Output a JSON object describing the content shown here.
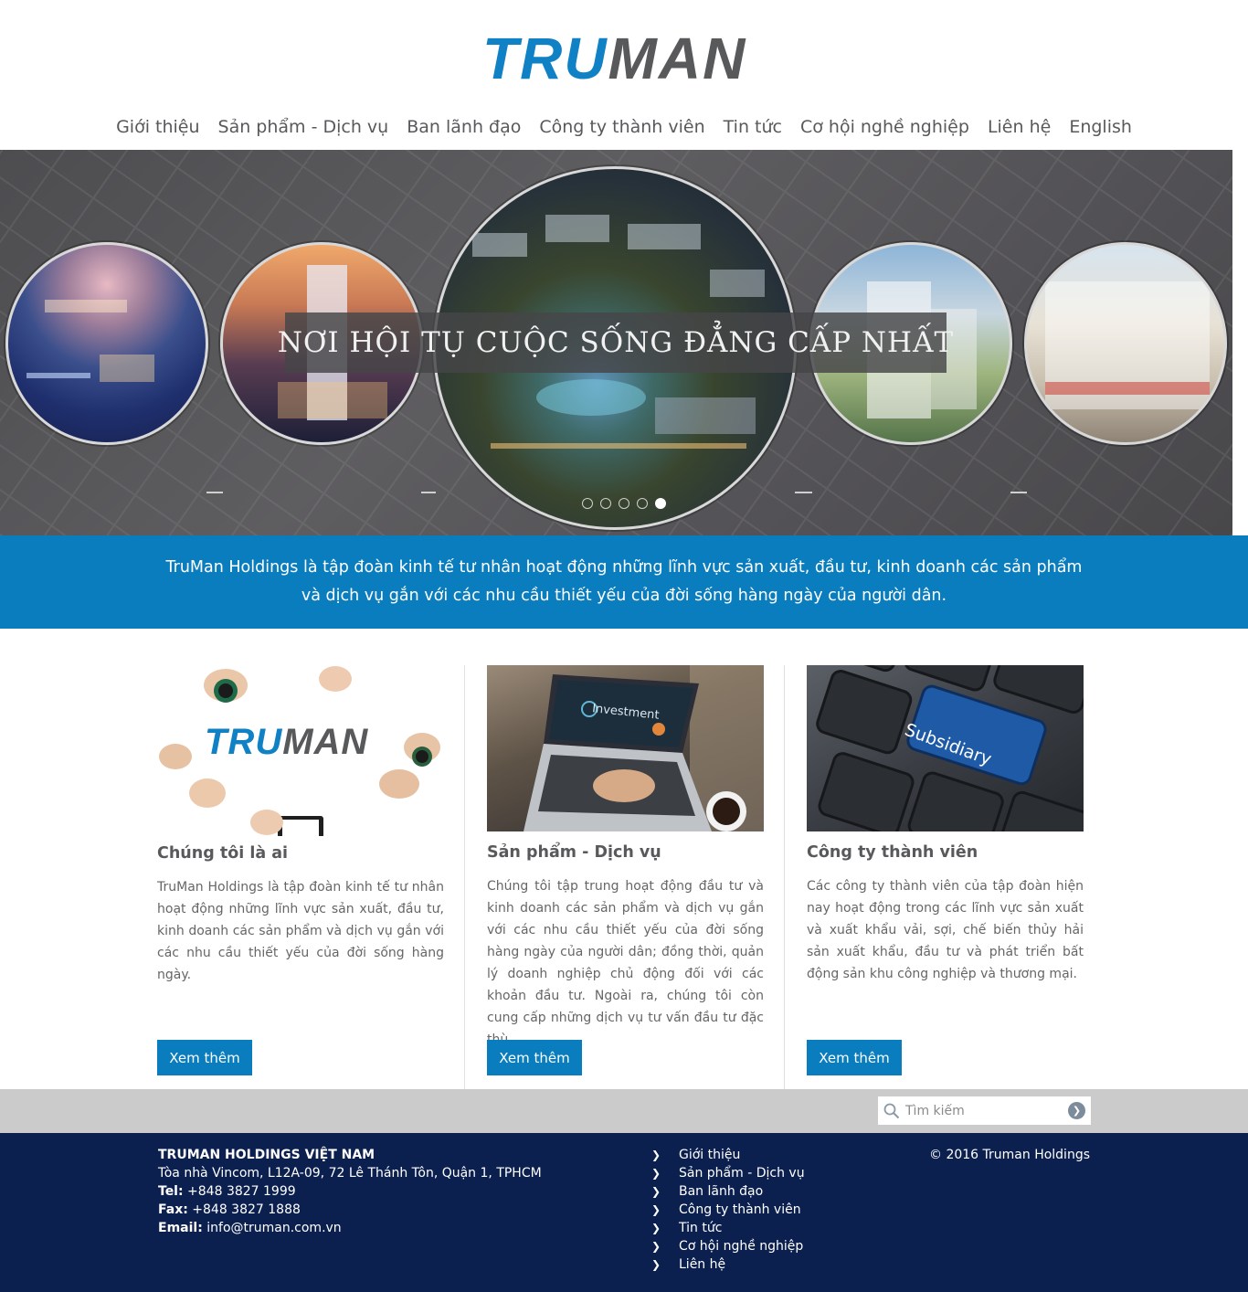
{
  "brand": {
    "logo_part1": "TRU",
    "logo_part2": "MAN",
    "color_blue": "#1081c4",
    "color_gray": "#58595b"
  },
  "nav": {
    "items": [
      "Giới thiệu",
      "Sản phẩm - Dịch vụ",
      "Ban lãnh đạo",
      "Công ty thành viên",
      "Tin tức",
      "Cơ hội nghề nghiệp",
      "Liên hệ",
      "English"
    ]
  },
  "slider": {
    "caption": "NƠI HỘI TỤ CUỘC SỐNG ĐẲNG CẤP NHẤT",
    "slide_count": 5,
    "active_slide": 5
  },
  "intro": {
    "line1": "TruMan Holdings là tập đoàn kinh tế tư nhân hoạt động những lĩnh vực sản xuất, đầu tư, kinh doanh các sản phẩm",
    "line2": "và dịch vụ gắn với các nhu cầu thiết yếu của đời sống hàng ngày của người dân.",
    "background": "#0a7dbf"
  },
  "cards": [
    {
      "image_logo_part1": "TRU",
      "image_logo_part2": "MAN",
      "title": "Chúng tôi là ai",
      "text": "TruMan Holdings là tập đoàn kinh tế tư nhân hoạt động những lĩnh vực sản xuất, đầu tư, kinh doanh các sản phẩm và dịch vụ gắn với các nhu cầu thiết yếu của đời sống hàng ngày.",
      "button": "Xem thêm"
    },
    {
      "image_caption": "Investment",
      "title": "Sản phẩm - Dịch vụ",
      "text": "Chúng tôi tập trung hoạt động đầu tư và kinh doanh các sản phẩm và dịch vụ gắn với các nhu cầu thiết yếu của đời sống hàng ngày của người dân; đồng thời, quản lý doanh nghiệp chủ động đối với các khoản đầu tư. Ngoài ra, chúng tôi còn cung cấp những dịch vụ tư vấn đầu tư đặc thù.",
      "button": "Xem thêm"
    },
    {
      "image_caption": "Subsidiary",
      "title": "Công ty thành viên",
      "text": "Các công ty thành viên của tập đoàn hiện nay hoạt động trong các lĩnh vực sản xuất và xuất khẩu vải, sợi, chế biến thủy hải sản xuất khẩu, đầu tư và phát triển bất động sản khu công nghiệp và thương mại.",
      "button": "Xem thêm"
    }
  ],
  "search": {
    "placeholder": "Tìm kiếm",
    "icon": "search-icon",
    "go_icon": "arrow-circle-icon"
  },
  "footer": {
    "company_name": "TRUMAN HOLDINGS VIỆT NAM",
    "address": "Tòa nhà Vincom, L12A-09, 72 Lê Thánh Tôn, Quận 1, TPHCM",
    "tel_label": "Tel:",
    "tel": "+848 3827 1999",
    "fax_label": "Fax:",
    "fax": "+848 3827 1888",
    "email_label": "Email:",
    "email": "info@truman.com.vn",
    "links": [
      "Giới thiệu",
      "Sản phẩm - Dịch vụ",
      "Ban lãnh đạo",
      "Công ty thành viên",
      "Tin tức",
      "Cơ hội nghề nghiệp",
      "Liên hệ"
    ],
    "copyright": "© 2016 Truman Holdings",
    "background": "#0c2050"
  }
}
